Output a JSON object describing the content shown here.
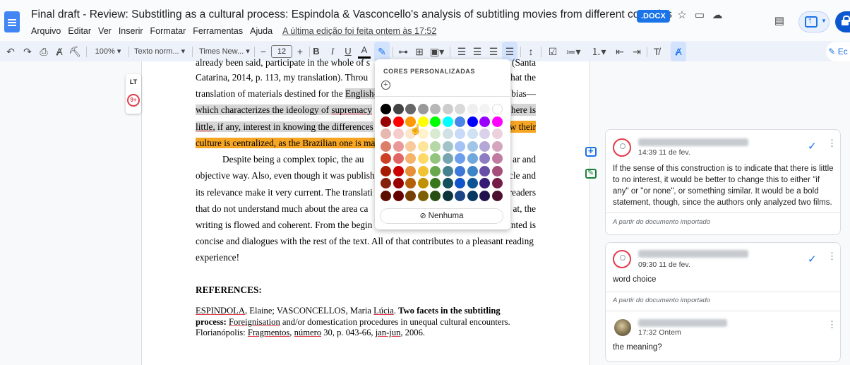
{
  "header": {
    "title": "Final draft - Review: Substitling as a cultural process: Espindola & Vasconcello's analysis of subtitling movies from different countries",
    "badge": ".DOCX",
    "menu": [
      "Arquivo",
      "Editar",
      "Ver",
      "Inserir",
      "Formatar",
      "Ferramentas",
      "Ajuda"
    ],
    "last_edit": "A última edição foi feita ontem às 17:52",
    "share_label": "Ec"
  },
  "toolbar": {
    "zoom": "100%",
    "style": "Texto norm...",
    "font": "Times New...",
    "font_size": "12",
    "bold": "B",
    "italic": "I",
    "underline": "U",
    "text_color": "A",
    "minus": "−",
    "plus": "+"
  },
  "sidebar_tools": {
    "lt_label": "LT",
    "issues_count": "9+"
  },
  "document": {
    "lines": [
      "already been said, participate in the whole of ... (Santa",
      "Catarina, 2014, p. 113, my translation). Throu... hat the",
      "translation of materials destined for the English-...bias—",
      "which characterizes the ideology of supremacy ... here is",
      "little, if any, interest in knowing the differences ... w their",
      "culture is centralized, as the Brazilian one is marg"
    ],
    "line1": "already been said, participate in the whole of s",
    "line1_tail": "(Santa",
    "line2": "Catarina, 2014, p. 113, my translation). Throu",
    "line2_tail": "hat the",
    "line3_a": "translation of materials destined for the ",
    "line3_b": "English-",
    "line3_tail": "bias—",
    "line4_a": "which characterizes the ideology of ",
    "line4_b": "supremacy",
    "line4_tail": "here is",
    "line5_a": "little",
    "line5_b": ", if any, interest in knowing the differences",
    "line5_tail": "w their",
    "line6": "culture is centralized, as the Brazilian one is marg",
    "para2_1": "Despite being a complex topic, the au",
    "para2_1_tail": "ar and",
    "para2_2": "objective way. Also, even though it was publishe",
    "para2_2_tail": "cle and",
    "para2_3": "its relevance make it very current. The translati",
    "para2_3_tail": "readers",
    "para2_4": "that do not understand much about the area ca",
    "para2_4_tail": "at, the",
    "para2_5": "writing is flowed and coherent. From the begin",
    "para2_5_tail": "nted is",
    "para2_6": "concise and dialogues with the rest of the text. All of that contributes to a pleasant reading",
    "para2_7": "experience!",
    "references_heading": "REFERENCES:",
    "ref_1a": "ESPINDOLA",
    "ref_1b": ", Elaine; VASCONCELLOS, Maria ",
    "ref_1c": "Lúcia",
    "ref_1d": ". ",
    "ref_1e": "Two facets in the subtitling",
    "ref_2a": "process: ",
    "ref_2b": "Foreignisation",
    "ref_2c": " and/or domestication procedures in unequal cultural encounters.",
    "ref_3a": "Florianópolis: ",
    "ref_3b": "Fragmentos",
    "ref_3c": ", ",
    "ref_3d": "número",
    "ref_3e": " 30, p. 043-66, ",
    "ref_3f": "jan-jun",
    "ref_3g": ", 2006."
  },
  "color_palette": {
    "title": "CORES PERSONALIZADAS",
    "add": "+",
    "none_label": "Nenhuma",
    "colors": [
      [
        "#000000",
        "#434343",
        "#666666",
        "#999999",
        "#b7b7b7",
        "#cccccc",
        "#d9d9d9",
        "#efefef",
        "#f3f3f3",
        "#ffffff"
      ],
      [
        "#980000",
        "#ff0000",
        "#ff9900",
        "#ffff00",
        "#00ff00",
        "#00ffff",
        "#4a86e8",
        "#0000ff",
        "#9900ff",
        "#ff00ff"
      ],
      [
        "#e6b8af",
        "#f4cccc",
        "#fce5cd",
        "#fff2cc",
        "#d9ead3",
        "#d0e0e3",
        "#c9daf8",
        "#cfe2f3",
        "#d9d2e9",
        "#ead1dc"
      ],
      [
        "#dd7e6b",
        "#ea9999",
        "#f9cb9c",
        "#ffe599",
        "#b6d7a8",
        "#a2c4c9",
        "#a4c2f4",
        "#9fc5e8",
        "#b4a7d6",
        "#d5a6bd"
      ],
      [
        "#cc4125",
        "#e06666",
        "#f6b26b",
        "#ffd966",
        "#93c47d",
        "#76a5af",
        "#6d9eeb",
        "#6fa8dc",
        "#8e7cc3",
        "#c27ba0"
      ],
      [
        "#a61c00",
        "#cc0000",
        "#e69138",
        "#f1c232",
        "#6aa84f",
        "#45818e",
        "#3c78d8",
        "#3d85c6",
        "#674ea7",
        "#a64d79"
      ],
      [
        "#85200c",
        "#990000",
        "#b45f06",
        "#bf9000",
        "#38761d",
        "#134f5c",
        "#1155cc",
        "#0b5394",
        "#351c75",
        "#741b47"
      ],
      [
        "#5b0f00",
        "#660000",
        "#783f04",
        "#7f6000",
        "#274e13",
        "#0c343d",
        "#1c4587",
        "#073763",
        "#20124d",
        "#4c1130"
      ]
    ]
  },
  "comments": [
    {
      "time": "14:39 11 de fev.",
      "text": "If the sense of this construction is to indicate that there is little to no interest, it would be better to change this to either \"if any\" or \"or none\", or something similar. It would be a bold statement, though, since the authors only analyzed two films.",
      "footer": "A partir do documento importado"
    },
    {
      "time": "09:30 11 de fev.",
      "text": "word choice",
      "footer": "A partir do documento importado",
      "reply_time": "17:32 Ontem",
      "reply_text": "the meaning?"
    }
  ]
}
